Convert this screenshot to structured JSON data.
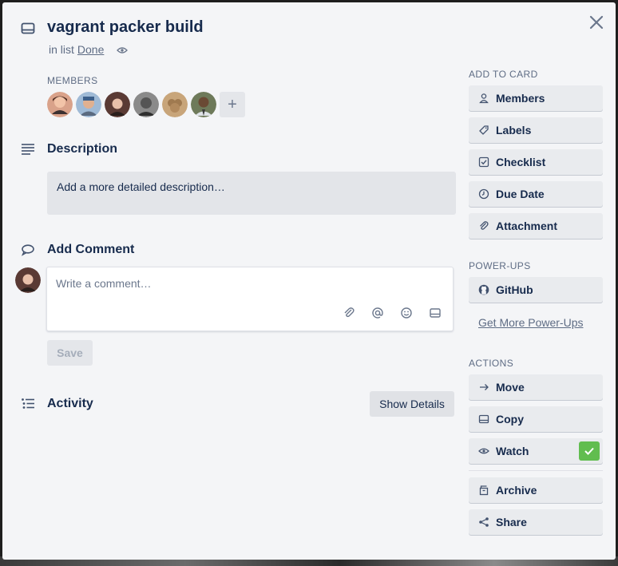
{
  "card": {
    "title": "vagrant packer build",
    "in_list_prefix": "in list",
    "list_name": "Done"
  },
  "members": {
    "label": "MEMBERS",
    "avatars": [
      {
        "name": "member-1",
        "color": "#c86b5a"
      },
      {
        "name": "member-2",
        "color": "#8aa9c8"
      },
      {
        "name": "member-3",
        "color": "#7a5048"
      },
      {
        "name": "member-4",
        "color": "#4a4a4a"
      },
      {
        "name": "member-5",
        "color": "#b08a62"
      },
      {
        "name": "member-6",
        "color": "#4d5a3c"
      }
    ],
    "add_label": "+"
  },
  "description": {
    "title": "Description",
    "placeholder": "Add a more detailed description…"
  },
  "comment": {
    "title": "Add Comment",
    "placeholder": "Write a comment…",
    "save_label": "Save"
  },
  "activity": {
    "title": "Activity",
    "show_details_label": "Show Details"
  },
  "sidebar": {
    "add_to_card_label": "ADD TO CARD",
    "add_to_card": [
      {
        "label": "Members",
        "icon": "person-icon"
      },
      {
        "label": "Labels",
        "icon": "tag-icon"
      },
      {
        "label": "Checklist",
        "icon": "checkbox-icon"
      },
      {
        "label": "Due Date",
        "icon": "clock-icon"
      },
      {
        "label": "Attachment",
        "icon": "paperclip-icon"
      }
    ],
    "power_ups_label": "POWER-UPS",
    "power_ups": [
      {
        "label": "GitHub",
        "icon": "github-icon"
      }
    ],
    "get_more_label": "Get More Power-Ups",
    "actions_label": "ACTIONS",
    "actions": [
      {
        "label": "Move",
        "icon": "arrow-right-icon"
      },
      {
        "label": "Copy",
        "icon": "card-icon"
      },
      {
        "label": "Watch",
        "icon": "eye-icon",
        "checked": true
      },
      {
        "label": "Archive",
        "icon": "archive-icon"
      },
      {
        "label": "Share",
        "icon": "share-icon"
      }
    ]
  },
  "colors": {
    "accent_green": "#61bd4f",
    "modal_bg": "#f4f5f7"
  }
}
